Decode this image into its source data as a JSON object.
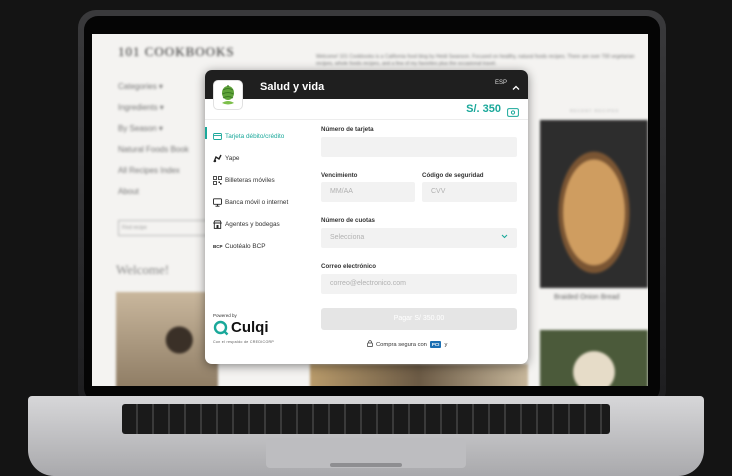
{
  "background_site": {
    "brand": "101 COOKBOOKS",
    "intro": "Welcome! 101 Cookbooks is a California food blog by Heidi Swanson. Focused on healthy, natural foods recipes. There are over 700 vegetarian recipes, whole foods recipes, and a few of my favorites plus the occasional travel.",
    "nav": [
      "Categories ▾",
      "Ingredients ▾",
      "By Season ▾",
      "Natural Foods Book",
      "All Recipes Index",
      "About"
    ],
    "search_placeholder": "Find recipe",
    "welcome": "Welcome!",
    "recent_label": "RECENT RECIPES",
    "food_caption": "Braided Onion Bread"
  },
  "checkout": {
    "merchant": "Salud y vida",
    "language": "ESP",
    "amount": "S/. 350",
    "accent_color": "#1aa89a",
    "methods": [
      {
        "label": "Tarjeta débito/crédito",
        "icon": "credit-card-icon",
        "active": true
      },
      {
        "label": "Yape",
        "icon": "yape-icon",
        "active": false
      },
      {
        "label": "Billeteras móviles",
        "icon": "qr-code-icon",
        "active": false
      },
      {
        "label": "Banca móvil o internet",
        "icon": "monitor-icon",
        "active": false
      },
      {
        "label": "Agentes y bodegas",
        "icon": "store-icon",
        "active": false
      },
      {
        "label": "Cuotéalo BCP",
        "icon": "bcp-icon",
        "active": false
      }
    ],
    "powered_by": "Powered by",
    "culqi": "Culqi",
    "credicorp": "Con el respaldo de CREDICORP",
    "form": {
      "card_number_label": "Número de tarjeta",
      "card_number_placeholder": "",
      "expiry_label": "Vencimiento",
      "expiry_placeholder": "MM/AA",
      "cvv_label": "Código de seguridad",
      "cvv_placeholder": "CVV",
      "installments_label": "Número de cuotas",
      "installments_value": "Selecciona",
      "email_label": "Correo electrónico",
      "email_placeholder": "correo@electronico.com",
      "pay_label": "Pagar S/ 350.00",
      "secure_text": "Compra segura con",
      "secure_suffix": "y",
      "pci_badge": "PCI"
    }
  }
}
